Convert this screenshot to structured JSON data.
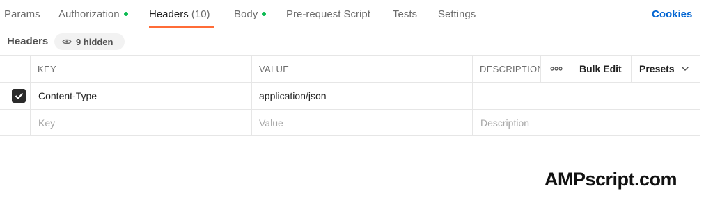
{
  "tabs": [
    {
      "label": "Params"
    },
    {
      "label": "Authorization",
      "has_dot": true
    },
    {
      "label": "Headers",
      "count": "(10)",
      "active": true
    },
    {
      "label": "Body",
      "has_dot": true
    },
    {
      "label": "Pre-request Script"
    },
    {
      "label": "Tests"
    },
    {
      "label": "Settings"
    }
  ],
  "cookies_label": "Cookies",
  "headers_section": {
    "title": "Headers",
    "hidden_pill": "9 hidden"
  },
  "table": {
    "columns": {
      "key": "KEY",
      "value": "VALUE",
      "description": "DESCRIPTION"
    },
    "actions": {
      "bulk_edit": "Bulk Edit",
      "presets": "Presets"
    },
    "rows": [
      {
        "checked": true,
        "key": "Content-Type",
        "value": "application/json",
        "description": ""
      }
    ],
    "placeholders": {
      "key": "Key",
      "value": "Value",
      "description": "Description"
    }
  },
  "brand": "AMPscript.com",
  "colors": {
    "accent_underline": "#ff6c37",
    "dot_green": "#0cbb52",
    "link_blue": "#0265d2"
  },
  "icons": {
    "hidden_pill": "eye-icon",
    "more": "more-horizontal-icon",
    "presets": "chevron-down-icon",
    "checkbox": "check-icon"
  }
}
